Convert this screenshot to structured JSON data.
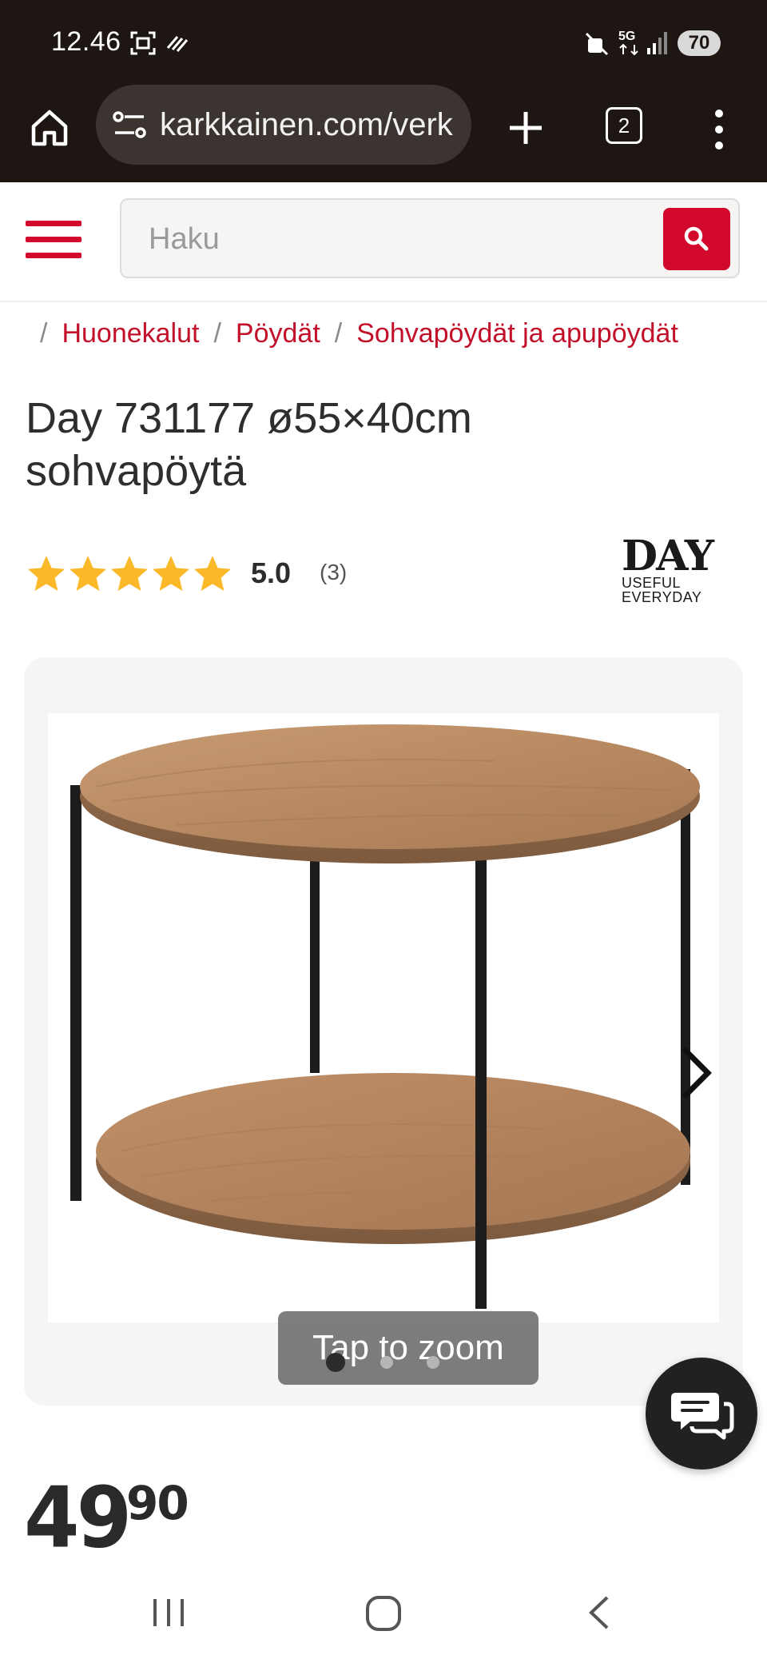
{
  "status_bar": {
    "time": "12.46",
    "battery": "70",
    "network": "5G",
    "icons": [
      "screenshot-icon",
      "nfc-icon",
      "mute-icon",
      "network-5g-icon",
      "signal-icon",
      "battery-icon"
    ]
  },
  "browser": {
    "url": "karkkainen.com/verk",
    "tab_count": "2",
    "icons": [
      "home-icon",
      "site-settings-icon",
      "new-tab-icon",
      "tabs-icon",
      "more-menu-icon"
    ]
  },
  "header": {
    "search_placeholder": "Haku",
    "icons": [
      "hamburger-menu-icon",
      "search-icon"
    ]
  },
  "breadcrumb": {
    "items": [
      "Huonekalut",
      "Pöydät",
      "Sohvapöydät ja apupöydät"
    ]
  },
  "product": {
    "title_line1": "Day 731177 ø55×40cm",
    "title_line2": "sohvapöytä",
    "rating": "5.0",
    "rating_stars": 5,
    "review_count": "(3)",
    "brand": {
      "name": "DAY",
      "tagline_line1": "USEFUL",
      "tagline_line2": "EVERYDAY"
    },
    "gallery": {
      "zoom_label": "Tap to zoom",
      "image_count": 3,
      "active_index": 0
    },
    "price_euros": "49",
    "price_cents": "90"
  },
  "colors": {
    "accent_red": "#d2092c",
    "breadcrumb_red": "#c2102a",
    "star_gold": "#fbb829",
    "browser_dark": "#1e1612"
  }
}
